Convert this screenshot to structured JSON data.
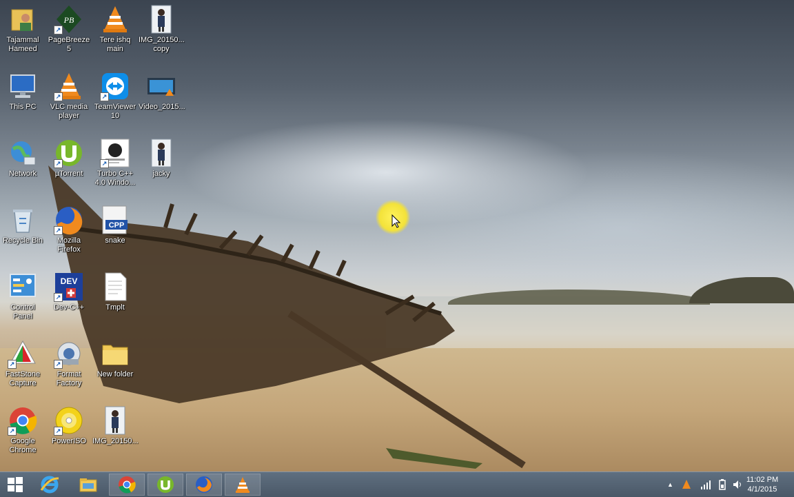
{
  "desktop": {
    "icons": [
      {
        "label": "Tajammal Hameed",
        "icon": "user-folder-icon"
      },
      {
        "label": "PageBreeze 5",
        "icon": "pagebreeze-icon"
      },
      {
        "label": "Tere ishq main",
        "icon": "vlc-file-icon"
      },
      {
        "label": "IMG_20150... copy",
        "icon": "photo-icon"
      },
      {
        "label": "This PC",
        "icon": "computer-icon"
      },
      {
        "label": "VLC media player",
        "icon": "vlc-icon"
      },
      {
        "label": "TeamViewer 10",
        "icon": "teamviewer-icon"
      },
      {
        "label": "Video_2015...",
        "icon": "video-icon"
      },
      {
        "label": "Network",
        "icon": "network-icon"
      },
      {
        "label": "µTorrent",
        "icon": "utorrent-icon"
      },
      {
        "label": "Turbo C++ 4.0 Windo...",
        "icon": "turbo-cpp-icon"
      },
      {
        "label": "jacky",
        "icon": "photo-icon"
      },
      {
        "label": "Recycle Bin",
        "icon": "recycle-bin-icon"
      },
      {
        "label": "Mozilla Firefox",
        "icon": "firefox-icon"
      },
      {
        "label": "snake",
        "icon": "cpp-file-icon"
      },
      {
        "label": "Control Panel",
        "icon": "control-panel-icon"
      },
      {
        "label": "Dev-C++",
        "icon": "dev-cpp-icon"
      },
      {
        "label": "Tmplt",
        "icon": "text-file-icon"
      },
      {
        "label": "FastStone Capture",
        "icon": "faststone-icon"
      },
      {
        "label": "Format Factory",
        "icon": "format-factory-icon"
      },
      {
        "label": "New folder",
        "icon": "folder-icon"
      },
      {
        "label": "Google Chrome",
        "icon": "chrome-icon"
      },
      {
        "label": "PowerISO",
        "icon": "poweriso-icon"
      },
      {
        "label": "IMG_20150...",
        "icon": "photo-icon"
      }
    ]
  },
  "taskbar": {
    "start": "start-icon",
    "pinned": [
      "internet-explorer-icon",
      "file-explorer-icon",
      "chrome-icon",
      "utorrent-icon",
      "firefox-icon",
      "vlc-icon"
    ],
    "tray": {
      "show_hidden": "▲",
      "time": "11:02 PM",
      "date": "4/1/2015"
    }
  },
  "colors": {
    "taskbar": "#4f5d6c",
    "cursor_highlight": "#f3e23a"
  }
}
